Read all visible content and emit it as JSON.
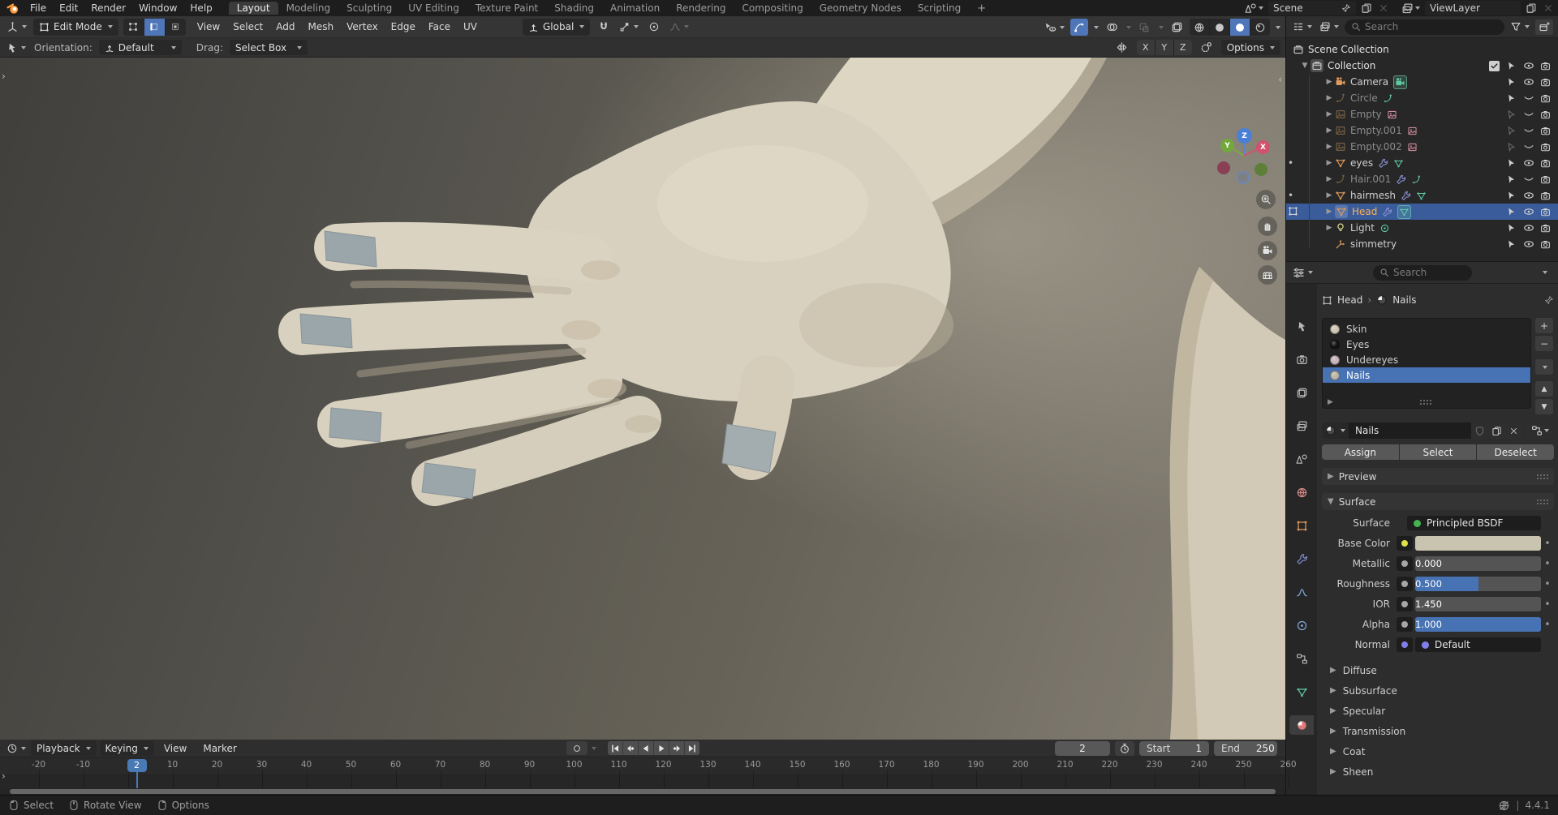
{
  "app": {
    "version": "4.4.1"
  },
  "colors": {
    "accent": "#4772b3",
    "selection_row": "#3a5c9b",
    "active_object_text": "#ffb054",
    "base_color_swatch": "#c9c4af"
  },
  "topbar": {
    "menus": [
      "File",
      "Edit",
      "Render",
      "Window",
      "Help"
    ],
    "workspaces": [
      "Layout",
      "Modeling",
      "Sculpting",
      "UV Editing",
      "Texture Paint",
      "Shading",
      "Animation",
      "Rendering",
      "Compositing",
      "Geometry Nodes",
      "Scripting"
    ],
    "active_workspace": "Layout",
    "add_workspace_label": "+",
    "scene_name": "Scene",
    "view_layer_name": "ViewLayer"
  },
  "viewport": {
    "header": {
      "mode": "Edit Mode",
      "menus": [
        "View",
        "Select",
        "Add",
        "Mesh",
        "Vertex",
        "Edge",
        "Face",
        "UV"
      ],
      "transform_orientation": "Global"
    },
    "tool_settings": {
      "orientation_label": "Orientation:",
      "orientation_value": "Default",
      "drag_label": "Drag:",
      "drag_value": "Select Box",
      "axis_buttons": [
        "X",
        "Y",
        "Z"
      ],
      "options_label": "Options"
    },
    "nav_axes": {
      "x": "X",
      "y": "Y",
      "z": "Z"
    }
  },
  "outliner": {
    "search_placeholder": "Search",
    "rows": [
      {
        "name": "Scene Collection",
        "icon": "collection",
        "level": 0
      },
      {
        "name": "Collection",
        "icon": "collection",
        "level": 1,
        "expanded": true,
        "icon_boxed": true,
        "checkbox": true,
        "select": "on",
        "eye": "open",
        "camera": true
      },
      {
        "name": "Camera",
        "icon": "camera",
        "level": 2,
        "expandable": true,
        "badges": [
          "camera-data-boxed"
        ],
        "select": "on",
        "eye": "open",
        "camera": true
      },
      {
        "name": "Circle",
        "icon": "curve",
        "level": 2,
        "dim": true,
        "expandable": true,
        "badges": [
          "curve-data"
        ],
        "select": "on",
        "eye": "closed",
        "camera": true
      },
      {
        "name": "Empty",
        "icon": "image",
        "level": 2,
        "dim": true,
        "expandable": true,
        "badges": [
          "image-data"
        ],
        "select": "dim",
        "eye": "closed",
        "camera": true
      },
      {
        "name": "Empty.001",
        "icon": "image",
        "level": 2,
        "dim": true,
        "expandable": true,
        "badges": [
          "image-data"
        ],
        "select": "dim",
        "eye": "closed",
        "camera": true
      },
      {
        "name": "Empty.002",
        "icon": "image",
        "level": 2,
        "dim": true,
        "expandable": true,
        "badges": [
          "image-data"
        ],
        "select": "dim",
        "eye": "closed",
        "camera": true
      },
      {
        "name": "eyes",
        "icon": "mesh",
        "level": 2,
        "expandable": true,
        "dot": true,
        "badges": [
          "wrench",
          "mesh-data"
        ],
        "select": "on",
        "eye": "open",
        "camera": true
      },
      {
        "name": "Hair.001",
        "icon": "curve",
        "level": 2,
        "dim": true,
        "expandable": true,
        "badges": [
          "wrench",
          "curve-data"
        ],
        "select": "on",
        "eye": "closed",
        "camera": true
      },
      {
        "name": "hairmesh",
        "icon": "mesh",
        "level": 2,
        "expandable": true,
        "dot": true,
        "badges": [
          "wrench",
          "mesh-data"
        ],
        "select": "on",
        "eye": "open",
        "camera": true
      },
      {
        "name": "Head",
        "icon": "mesh",
        "level": 2,
        "expandable": true,
        "selected": true,
        "active": true,
        "icon_boxed": true,
        "edit_badge": true,
        "badges": [
          "wrench",
          "mesh-data-boxed"
        ],
        "select": "on",
        "eye": "open",
        "camera": true
      },
      {
        "name": "Light",
        "icon": "light",
        "level": 2,
        "expandable": true,
        "badges": [
          "light-data"
        ],
        "select": "on",
        "eye": "open",
        "camera": true
      },
      {
        "name": "simmetry",
        "icon": "empty",
        "level": 2,
        "select": "on",
        "eye": "open",
        "camera": true
      }
    ]
  },
  "properties": {
    "search_placeholder": "Search",
    "breadcrumb": {
      "object": "Head",
      "material": "Nails"
    },
    "material_slots": [
      {
        "name": "Skin",
        "color": "#cec4b2"
      },
      {
        "name": "Eyes",
        "color": "#121212"
      },
      {
        "name": "Undereyes",
        "color": "#c8b4b8"
      },
      {
        "name": "Nails",
        "color": "#bab6a8",
        "selected": true
      }
    ],
    "material_name": "Nails",
    "action_buttons": [
      "Assign",
      "Select",
      "Deselect"
    ],
    "preview_label": "Preview",
    "surface_label": "Surface",
    "surface_rows": [
      {
        "label": "Surface",
        "widget": "node",
        "value": "Principled BSDF",
        "node_dot": "#44b34f"
      },
      {
        "label": "Base Color",
        "widget": "swatch",
        "socket": "#e0e04a",
        "swatch": "#c9c4af",
        "animatable": true
      },
      {
        "label": "Metallic",
        "widget": "slider",
        "value": "0.000",
        "fill": 0,
        "socket": "#a6a6a6",
        "animatable": true
      },
      {
        "label": "Roughness",
        "widget": "slider",
        "value": "0.500",
        "fill": 0.5,
        "socket": "#a6a6a6",
        "animatable": true
      },
      {
        "label": "IOR",
        "widget": "slider",
        "value": "1.450",
        "fill": 0,
        "socket": "#a6a6a6",
        "animatable": true
      },
      {
        "label": "Alpha",
        "widget": "slider",
        "value": "1.000",
        "fill": 1,
        "socket": "#a6a6a6",
        "animatable": true
      },
      {
        "label": "Normal",
        "widget": "node",
        "value": "Default",
        "socket": "#8080e8"
      }
    ],
    "collapsed_sections": [
      "Diffuse",
      "Subsurface",
      "Specular",
      "Transmission",
      "Coat",
      "Sheen"
    ],
    "tabs": [
      "tool",
      "render",
      "output",
      "view-layer",
      "scene",
      "world",
      "object",
      "modifiers",
      "particles",
      "physics",
      "constraints",
      "data",
      "material"
    ],
    "active_tab": "material"
  },
  "timeline": {
    "menus": [
      "Playback",
      "Keying",
      "View",
      "Marker"
    ],
    "current_frame": "2",
    "start_label": "Start",
    "start_value": "1",
    "end_label": "End",
    "end_value": "250",
    "ruler_labels": [
      "-20",
      "-10",
      "10",
      "20",
      "30",
      "40",
      "50",
      "60",
      "70",
      "80",
      "90",
      "100",
      "110",
      "120",
      "130",
      "140",
      "150",
      "160",
      "170",
      "180",
      "190",
      "200",
      "210",
      "220",
      "230",
      "240",
      "250",
      "260"
    ]
  },
  "statusbar": {
    "hints": [
      {
        "icon": "mouse-left",
        "label": "Select"
      },
      {
        "icon": "mouse-middle",
        "label": "Rotate View"
      },
      {
        "icon": "mouse-right",
        "label": "Options"
      }
    ],
    "version": "4.4.1"
  }
}
